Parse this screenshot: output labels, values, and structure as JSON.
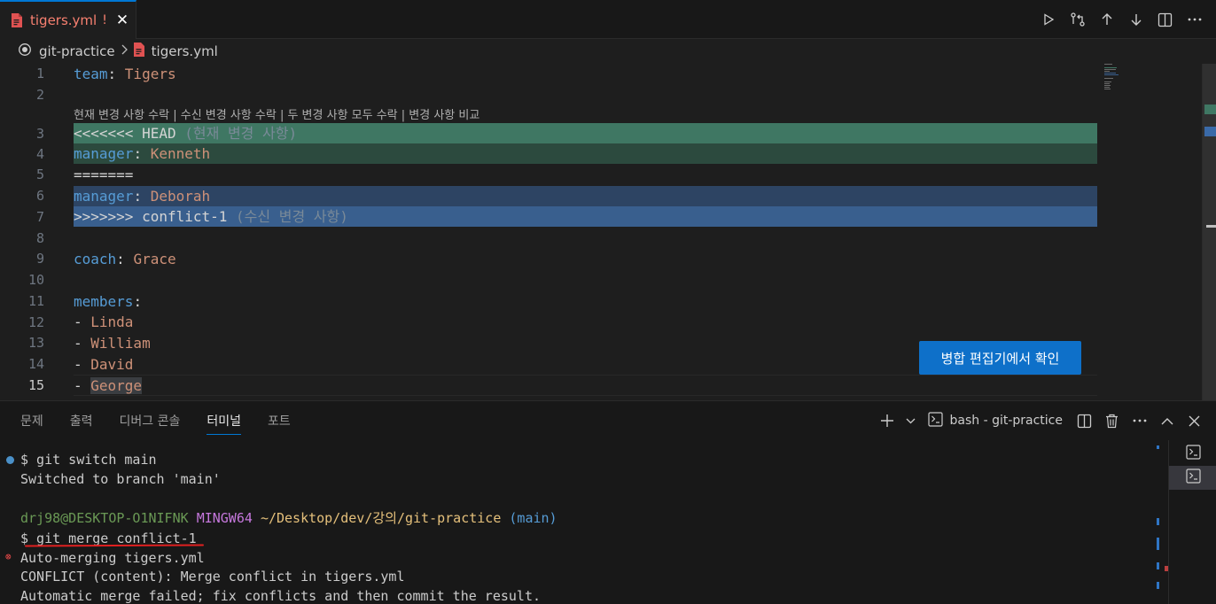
{
  "tab": {
    "title": "tigers.yml",
    "modified_marker": "!",
    "close_glyph": "✕"
  },
  "editor_actions": [
    "run-icon",
    "compare-changes-icon",
    "arrow-up-icon",
    "arrow-down-icon",
    "split-editor-icon",
    "more-actions-icon"
  ],
  "breadcrumb": {
    "folder": "git-practice",
    "file": "tigers.yml"
  },
  "gutter": [
    "1",
    "2",
    "3",
    "4",
    "5",
    "6",
    "7",
    "8",
    "9",
    "10",
    "11",
    "12",
    "13",
    "14",
    "15"
  ],
  "code": {
    "l1_key": "team",
    "l1_val": "Tigers",
    "codelens": {
      "accept_current": "현재 변경 사항 수락",
      "accept_incoming": "수신 변경 사항 수락",
      "accept_both": "두 변경 사항 모두 수락",
      "compare": "변경 사항 비교",
      "sep": " | "
    },
    "l3_marker": "<<<<<<< HEAD",
    "l3_hint": "(현재 변경 사항)",
    "l4_key": "manager",
    "l4_val": "Kenneth",
    "l5_sep": "=======",
    "l6_key": "manager",
    "l6_val": "Deborah",
    "l7_marker": ">>>>>>> conflict-1",
    "l7_hint": "(수신 변경 사항)",
    "l9_key": "coach",
    "l9_val": "Grace",
    "l11_key": "members",
    "l12_val": "Linda",
    "l13_val": "William",
    "l14_val": "David",
    "l15_val": "George",
    "dash": "- ",
    "colon": ": "
  },
  "merge_editor_button": "병합 편집기에서 확인",
  "panel": {
    "tabs": [
      "문제",
      "출력",
      "디버그 콘솔",
      "터미널",
      "포트"
    ],
    "active_tab": "터미널",
    "terminal_name": "bash - git-practice"
  },
  "terminal": {
    "cmd1": "$ git switch main",
    "out1": "Switched to branch 'main'",
    "prompt_user": "drj98@DESKTOP-O1NIFNK",
    "prompt_env": "MINGW64",
    "prompt_path": "~/Desktop/dev/강의/git-practice",
    "prompt_branch": "(main)",
    "cmd2": "$ git merge conflict-1",
    "out2": "Auto-merging tigers.yml",
    "out3": "CONFLICT (content): Merge conflict in tigers.yml",
    "out4": "Automatic merge failed; fix conflicts and then commit the result."
  },
  "colors": {
    "accent": "#0078d4",
    "current_change": "#3f7763",
    "incoming_change": "#395f8e",
    "error": "#f14c4c"
  }
}
